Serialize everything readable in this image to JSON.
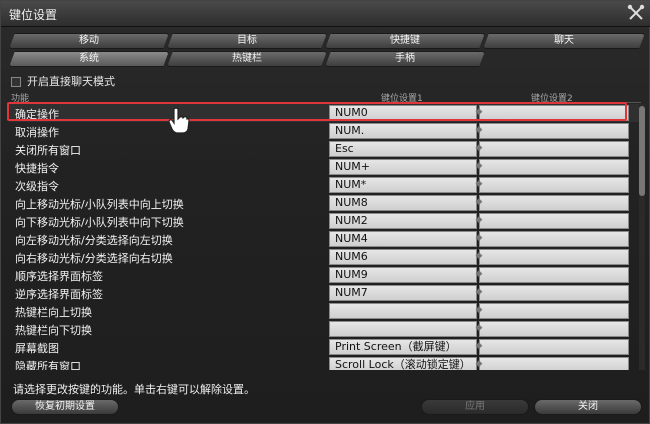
{
  "window": {
    "title": "键位设置"
  },
  "tabs_row1": [
    {
      "label": "移动",
      "active": false
    },
    {
      "label": "目标",
      "active": false
    },
    {
      "label": "快捷键",
      "active": false
    },
    {
      "label": "聊天",
      "active": false
    }
  ],
  "tabs_row2": [
    {
      "label": "系统",
      "active": true
    },
    {
      "label": "热键栏",
      "active": false
    },
    {
      "label": "手柄",
      "active": false
    }
  ],
  "option": {
    "direct_chat_label": "开启直接聊天模式",
    "checked": false
  },
  "columns": {
    "function": "功能",
    "key1": "键位设置1",
    "key2": "键位设置2"
  },
  "rows": [
    {
      "name": "确定操作",
      "key1": "NUM0",
      "key2": ""
    },
    {
      "name": "取消操作",
      "key1": "NUM.",
      "key2": ""
    },
    {
      "name": "关闭所有窗口",
      "key1": "Esc",
      "key2": ""
    },
    {
      "name": "快捷指令",
      "key1": "NUM+",
      "key2": ""
    },
    {
      "name": "次级指令",
      "key1": "NUM*",
      "key2": ""
    },
    {
      "name": "向上移动光标/小队列表中向上切换",
      "key1": "NUM8",
      "key2": ""
    },
    {
      "name": "向下移动光标/小队列表中向下切换",
      "key1": "NUM2",
      "key2": ""
    },
    {
      "name": "向左移动光标/分类选择向左切换",
      "key1": "NUM4",
      "key2": ""
    },
    {
      "name": "向右移动光标/分类选择向右切换",
      "key1": "NUM6",
      "key2": ""
    },
    {
      "name": "顺序选择界面标签",
      "key1": "NUM9",
      "key2": ""
    },
    {
      "name": "逆序选择界面标签",
      "key1": "NUM7",
      "key2": ""
    },
    {
      "name": "热键栏向上切换",
      "key1": "",
      "key2": ""
    },
    {
      "name": "热键栏向下切换",
      "key1": "",
      "key2": ""
    },
    {
      "name": "屏幕截图",
      "key1": "Print Screen（截屏键）",
      "key2": ""
    },
    {
      "name": "隐藏所有窗口",
      "key1": "Scroll Lock（滚动锁定键）",
      "key2": ""
    }
  ],
  "footer": {
    "hint": "请选择更改按键的功能。单击右键可以解除设置。",
    "reset_label": "恢复初期设置",
    "apply_label": "应用",
    "close_label": "关闭"
  },
  "colors": {
    "selection": "#e0353a",
    "accent": "#e6e6e6"
  }
}
